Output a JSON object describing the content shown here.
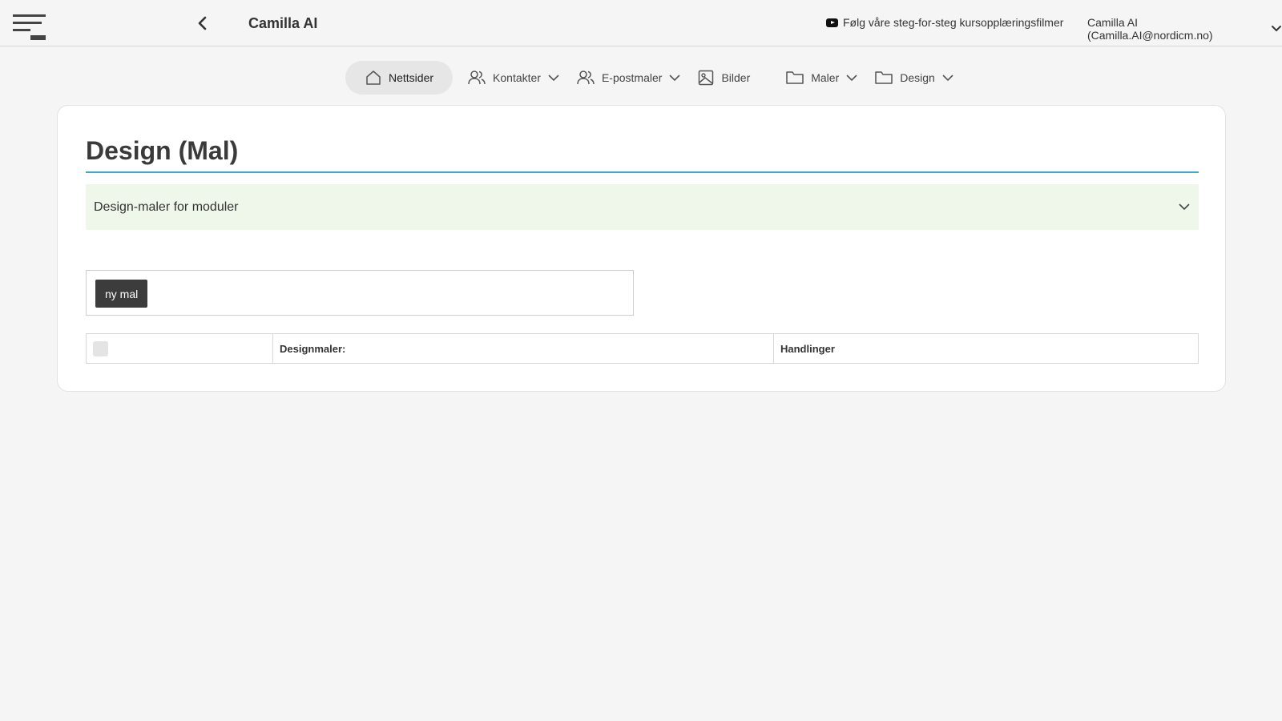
{
  "header": {
    "app_title": "Camilla AI",
    "training_link": "Følg våre steg-for-steg kursopplæringsfilmer",
    "user_label": "Camilla AI (Camilla.AI@nordicm.no)"
  },
  "nav": {
    "items": [
      {
        "label": "Nettsider",
        "icon": "home-icon",
        "active": true
      },
      {
        "label": "Kontakter",
        "icon": "users-icon"
      },
      {
        "label": "E-postmaler",
        "icon": "users-icon"
      },
      {
        "label": "Bilder",
        "icon": "image-icon"
      },
      {
        "label": "Maler",
        "icon": "folder-icon"
      },
      {
        "label": "Design",
        "icon": "folder-icon"
      }
    ]
  },
  "main": {
    "title": "Design (Mal)",
    "accordion_label": "Design-maler for moduler",
    "new_button_label": "ny mal",
    "table": {
      "headers": [
        "",
        "Designmaler:",
        "Handlinger"
      ]
    }
  },
  "colors": {
    "accent_rule": "#3fa9c9",
    "accordion_bg": "#eef7ea",
    "button_bg": "#3c3c3c"
  }
}
